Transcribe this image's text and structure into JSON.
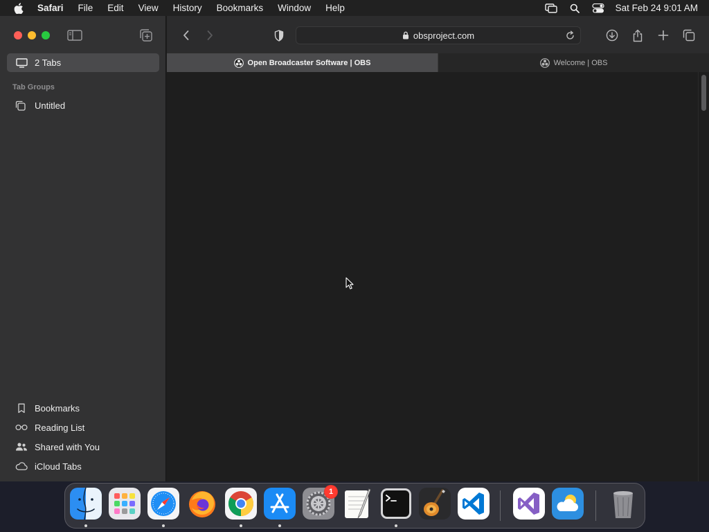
{
  "menubar": {
    "app_name": "Safari",
    "items": [
      "File",
      "Edit",
      "View",
      "History",
      "Bookmarks",
      "Window",
      "Help"
    ],
    "clock": "Sat Feb 24  9:01 AM"
  },
  "sidebar": {
    "tabs_label": "2 Tabs",
    "section_label": "Tab Groups",
    "group_label": "Untitled",
    "bottom": {
      "bookmarks": "Bookmarks",
      "reading_list": "Reading List",
      "shared": "Shared with You",
      "icloud": "iCloud Tabs"
    }
  },
  "toolbar": {
    "url": "obsproject.com"
  },
  "tabs": [
    {
      "title": "Open Broadcaster Software | OBS",
      "active": true
    },
    {
      "title": "Welcome | OBS",
      "active": false
    }
  ],
  "dock": {
    "apps": [
      "Finder",
      "Launchpad",
      "Safari",
      "Firefox",
      "Google Chrome",
      "App Store",
      "System Settings",
      "TextEdit",
      "Terminal",
      "GarageBand",
      "Visual Studio Code",
      "Visual Studio",
      "Weather",
      "Trash"
    ],
    "settings_badge": "1"
  },
  "colors": {
    "close": "#ff5f57",
    "minimize": "#febc2e",
    "zoom": "#28c840",
    "badge": "#ff3b30"
  }
}
